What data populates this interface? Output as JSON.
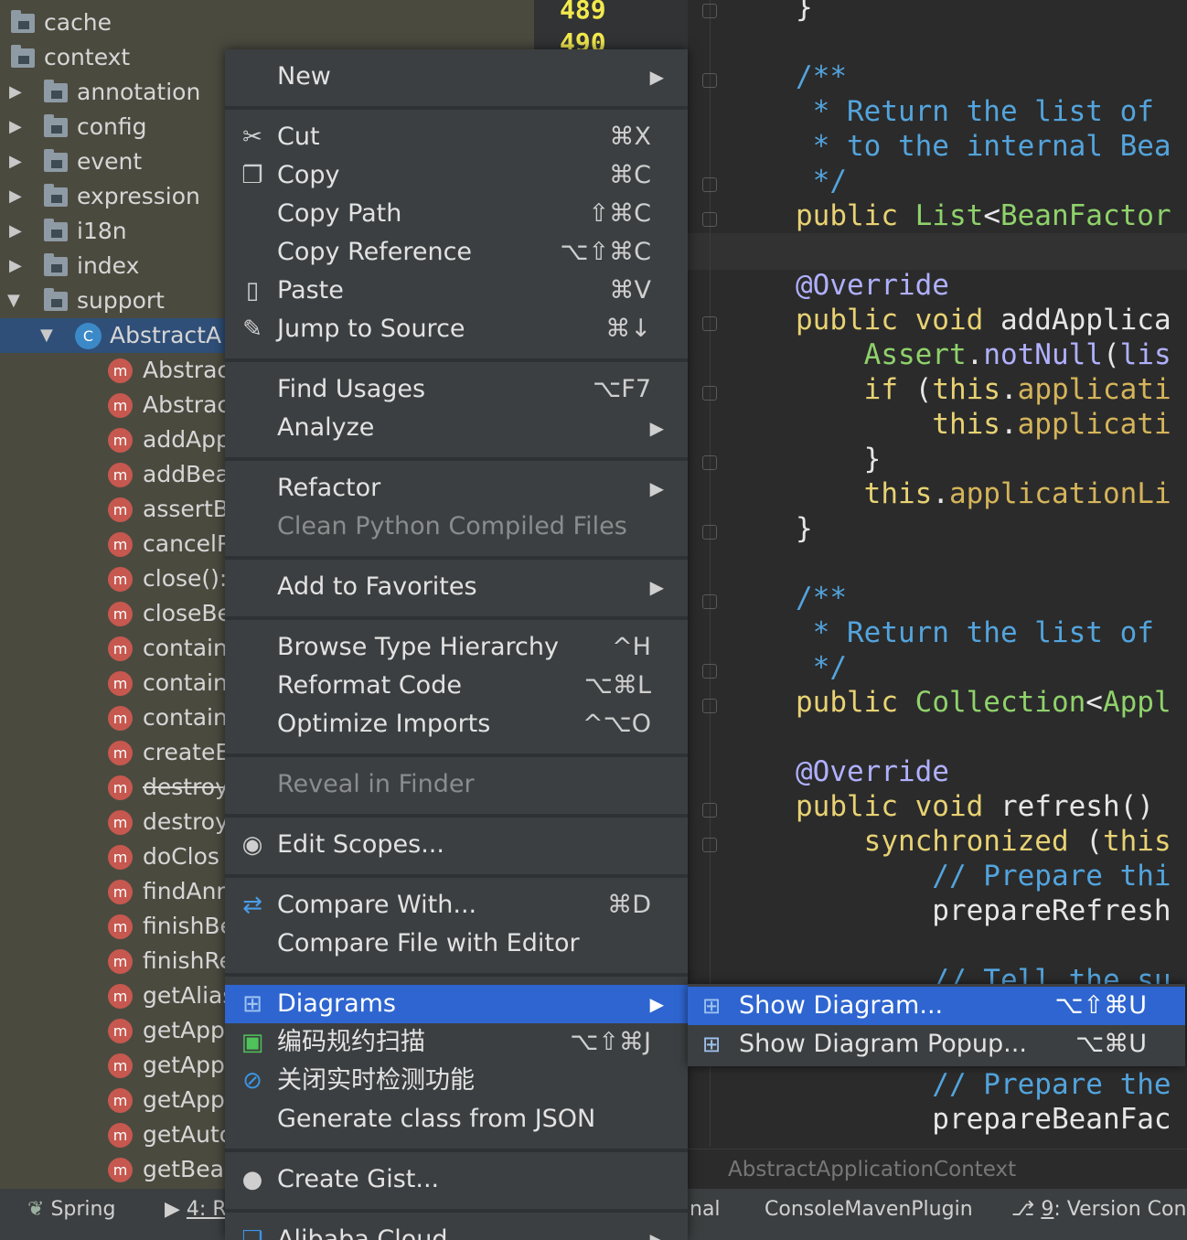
{
  "tree": {
    "folders": [
      {
        "label": "cache"
      },
      {
        "label": "context"
      },
      {
        "label": "annotation"
      },
      {
        "label": "config"
      },
      {
        "label": "event"
      },
      {
        "label": "expression"
      },
      {
        "label": "i18n"
      },
      {
        "label": "index"
      },
      {
        "label": "support"
      }
    ],
    "selected_class": "AbstractA",
    "members": [
      {
        "label": "Abstrac"
      },
      {
        "label": "Abstrac"
      },
      {
        "label": "addApp"
      },
      {
        "label": "addBea"
      },
      {
        "label": "assertB"
      },
      {
        "label": "cancelR"
      },
      {
        "label": "close():"
      },
      {
        "label": "closeBe"
      },
      {
        "label": "contain"
      },
      {
        "label": "contain"
      },
      {
        "label": "contain"
      },
      {
        "label": "createE"
      },
      {
        "label": "destroy"
      },
      {
        "label": "destroy"
      },
      {
        "label": "doClos"
      },
      {
        "label": "findAnr"
      },
      {
        "label": "finishBe"
      },
      {
        "label": "finishRe"
      },
      {
        "label": "getAlias"
      },
      {
        "label": "getApp"
      },
      {
        "label": "getApp"
      },
      {
        "label": "getApp"
      },
      {
        "label": "getAuto"
      },
      {
        "label": "getBear"
      }
    ]
  },
  "editor": {
    "line_numbers": [
      "489",
      "490"
    ],
    "breadcrumb": "AbstractApplicationContext"
  },
  "status": {
    "spring": "Spring",
    "run": "4: R",
    "terminal": "nal",
    "maven": "ConsoleMavenPlugin",
    "vcs_num": "9",
    "vcs": ": Version Contr"
  },
  "menu": {
    "new": "New",
    "cut": "Cut",
    "cut_sc": "⌘X",
    "copy": "Copy",
    "copy_sc": "⌘C",
    "copy_path": "Copy Path",
    "copy_path_sc": "⇧⌘C",
    "copy_ref": "Copy Reference",
    "copy_ref_sc": "⌥⇧⌘C",
    "paste": "Paste",
    "paste_sc": "⌘V",
    "jump": "Jump to Source",
    "jump_sc": "⌘↓",
    "find_usages": "Find Usages",
    "find_usages_sc": "⌥F7",
    "analyze": "Analyze",
    "refactor": "Refactor",
    "clean_python": "Clean Python Compiled Files",
    "favorites": "Add to Favorites",
    "browse_type": "Browse Type Hierarchy",
    "browse_type_sc": "^H",
    "reformat": "Reformat Code",
    "reformat_sc": "⌥⌘L",
    "optimize": "Optimize Imports",
    "optimize_sc": "^⌥O",
    "reveal": "Reveal in Finder",
    "edit_scopes": "Edit Scopes...",
    "compare_with": "Compare With...",
    "compare_with_sc": "⌘D",
    "compare_file": "Compare File with Editor",
    "diagrams": "Diagrams",
    "scan": "编码规约扫描",
    "scan_sc": "⌥⇧⌘J",
    "close_check": "关闭实时检测功能",
    "gen_json": "Generate class from JSON",
    "gist": "Create Gist...",
    "alibaba": "Alibaba Cloud"
  },
  "submenu": {
    "show_diagram": "Show Diagram...",
    "show_diagram_sc": "⌥⇧⌘U",
    "show_popup": "Show Diagram Popup...",
    "show_popup_sc": "⌥⌘U"
  }
}
